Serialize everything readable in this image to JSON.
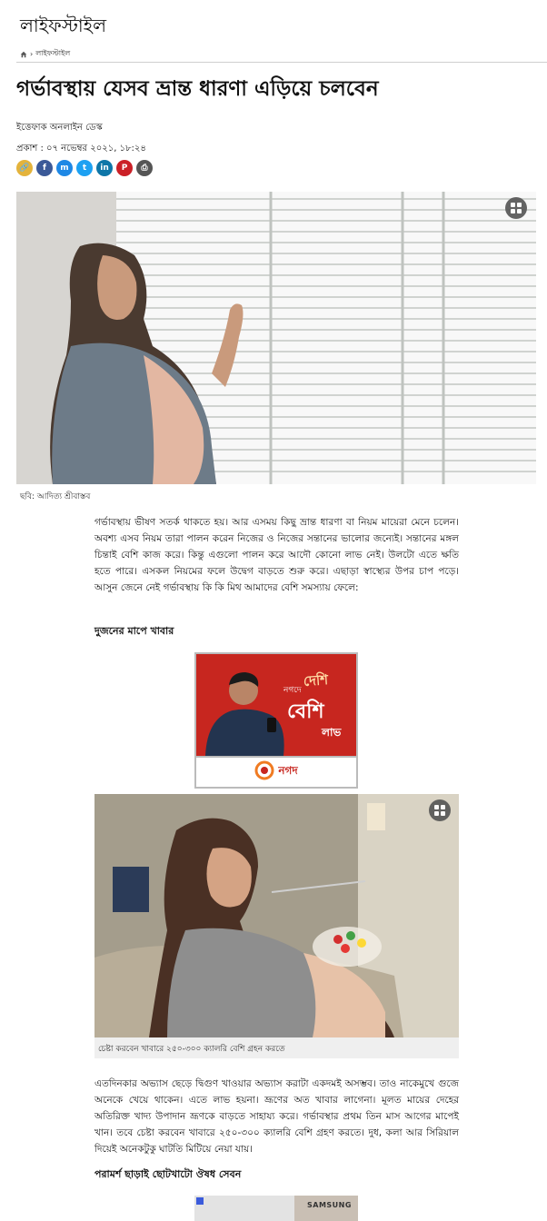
{
  "section": {
    "title": "লাইফস্টাইল"
  },
  "breadcrumb": {
    "sep": "›",
    "current": "লাইফস্টাইল"
  },
  "article": {
    "headline": "গর্ভাবস্থায় যেসব ভ্রান্ত ধারণা এড়িয়ে চলবেন",
    "author": "ইত্তেফাক অনলাইন ডেস্ক",
    "published": "প্রকাশ : ০৭ নভেম্বর ২০২১, ১৮:২৪",
    "hero_caption": "ছবি: আদিত্য শ্রীবাস্তব",
    "paragraph1": "গর্ভাবস্থায় ভীষণ সতর্ক থাকতে হয়। আর এসময় কিছু ভ্রান্ত ধারণা বা নিয়ম মায়েরা মেনে চলেন। অবশ্য এসব নিয়ম তারা পালন করেন নিজের ও নিজের সন্তানের ভালোর জন্যেই। সন্তানের মঙ্গল চিন্তাই বেশি কাজ করে। কিন্তু এগুলো পালন করে আদৌ কোনো লাভ নেই। উলটো এতে ক্ষতি হতে পারে। এসকল নিয়মের ফলে উদ্বেগ বাড়তে শুরু করে। এছাড়া স্বাস্থ্যের উপর চাপ পড়ে। আসুন জেনে নেই গর্ভাবস্থায় কি কি মিথ আমাদের বেশি সমস্যায় ফেলে:",
    "subhead1": "দুজনের মাপে খাবার",
    "image2_caption": "চেষ্টা করবেন খাবারে ২৫০-৩০০ ক্যালরি বেশি গ্রহন করতে",
    "paragraph2": "এতদিনকার অভ্যাস ছেড়ে দ্বিগুণ খাওয়ার অভ্যাস করাটা একদমই অসম্ভব। তাও নাকেমুখে গুজে অনেকে খেয়ে থাকেন। এতে লাভ হয়না। ভ্রূণের অত খাবার লাগেনা। মূলত মায়ের দেহের অতিরিক্ত খাদ্য উপাদান ভ্রূণকে বাড়তে সাহায্য করে। গর্ভাবস্থার প্রথম তিন মাস আগের মাপেই খান। তবে চেষ্টা করবেন খাবারে ২৫০-৩০০ ক্যালরি বেশি গ্রহণ করতে। দুধ, কলা আর সিরিয়াল দিয়েই অনেকটুকু ঘাটতি মিটিয়ে নেয়া যায়।",
    "subhead2": "পরামর্শ ছাড়াই ছোটখাটো ঔষধ সেবন"
  },
  "share": {
    "buttons": [
      {
        "icon": "link-icon",
        "glyph": "🔗",
        "color": "#e4b33b"
      },
      {
        "icon": "facebook-icon",
        "glyph": "f",
        "color": "#3b5998"
      },
      {
        "icon": "messenger-icon",
        "glyph": "m",
        "color": "#1e88e5"
      },
      {
        "icon": "twitter-icon",
        "glyph": "t",
        "color": "#1da1f2"
      },
      {
        "icon": "linkedin-icon",
        "glyph": "in",
        "color": "#0e76a8"
      },
      {
        "icon": "pinterest-icon",
        "glyph": "P",
        "color": "#cb2027"
      },
      {
        "icon": "print-icon",
        "glyph": "⎙",
        "color": "#555555"
      }
    ]
  },
  "ads": {
    "nagad": {
      "text1": "দেশি",
      "text_small": "নগদে",
      "text2": "বেশি",
      "text3": "লাভ",
      "brand": "নগদ"
    },
    "samsung": {
      "brand": "SAMSUNG"
    }
  }
}
